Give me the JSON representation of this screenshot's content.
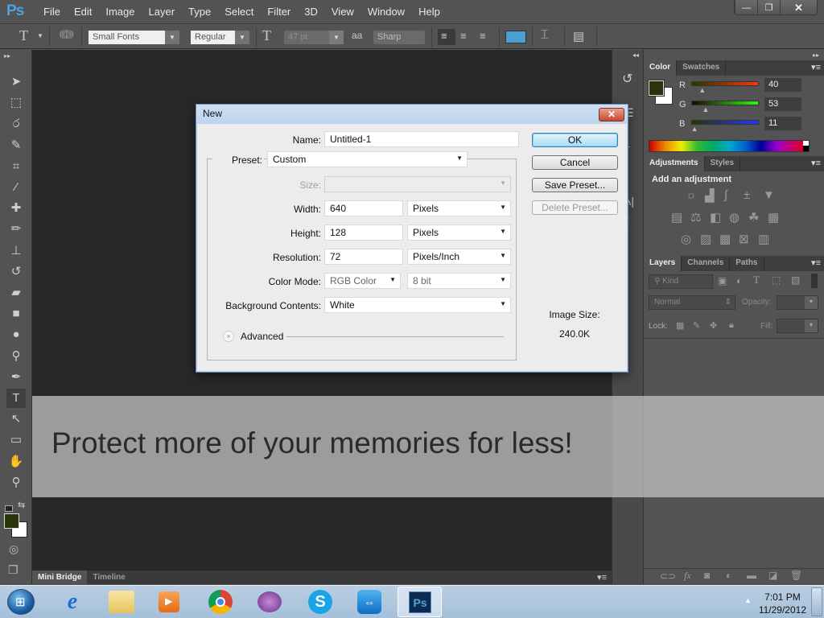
{
  "app": {
    "logo": "Ps"
  },
  "menu": [
    "File",
    "Edit",
    "Image",
    "Layer",
    "Type",
    "Select",
    "Filter",
    "3D",
    "View",
    "Window",
    "Help"
  ],
  "window_controls": {
    "minimize": "—",
    "restore": "❐",
    "close": "✕"
  },
  "options_bar": {
    "tool_icon": "T",
    "font_family": "Small Fonts",
    "font_style": "Regular",
    "font_size": "47 pt",
    "antialias_icon": "aa",
    "antialias": "Sharp",
    "text_color": "#4a9fd4"
  },
  "tools": [
    {
      "name": "move-tool",
      "glyph": "➤"
    },
    {
      "name": "marquee-tool",
      "glyph": "⬚"
    },
    {
      "name": "lasso-tool",
      "glyph": "ර"
    },
    {
      "name": "quick-select-tool",
      "glyph": "✎"
    },
    {
      "name": "crop-tool",
      "glyph": "⌗"
    },
    {
      "name": "eyedropper-tool",
      "glyph": "⁄"
    },
    {
      "name": "healing-brush-tool",
      "glyph": "✚"
    },
    {
      "name": "brush-tool",
      "glyph": "✏"
    },
    {
      "name": "clone-stamp-tool",
      "glyph": "⊥"
    },
    {
      "name": "history-brush-tool",
      "glyph": "↺"
    },
    {
      "name": "eraser-tool",
      "glyph": "▰"
    },
    {
      "name": "gradient-tool",
      "glyph": "■"
    },
    {
      "name": "blur-tool",
      "glyph": "●"
    },
    {
      "name": "dodge-tool",
      "glyph": "⚲"
    },
    {
      "name": "pen-tool",
      "glyph": "✒"
    },
    {
      "name": "type-tool",
      "glyph": "T"
    },
    {
      "name": "path-select-tool",
      "glyph": "↖"
    },
    {
      "name": "shape-tool",
      "glyph": "▭"
    },
    {
      "name": "hand-tool",
      "glyph": "✋"
    },
    {
      "name": "zoom-tool",
      "glyph": "⚲"
    }
  ],
  "swatches": {
    "foreground": "#28350b",
    "background": "#ffffff"
  },
  "mini_bridge": {
    "tabs": [
      "Mini Bridge",
      "Timeline"
    ]
  },
  "dialog": {
    "title": "New",
    "close": "✕",
    "name_label": "Name:",
    "name_value": "Untitled-1",
    "preset_label": "Preset:",
    "preset_value": "Custom",
    "size_label": "Size:",
    "size_value": "",
    "width_label": "Width:",
    "width_value": "640",
    "width_unit": "Pixels",
    "height_label": "Height:",
    "height_value": "128",
    "height_unit": "Pixels",
    "resolution_label": "Resolution:",
    "resolution_value": "72",
    "resolution_unit": "Pixels/Inch",
    "color_mode_label": "Color Mode:",
    "color_mode_value": "RGB Color",
    "bit_depth": "8 bit",
    "bg_label": "Background Contents:",
    "bg_value": "White",
    "advanced": "Advanced",
    "buttons": {
      "ok": "OK",
      "cancel": "Cancel",
      "save_preset": "Save Preset...",
      "delete_preset": "Delete Preset..."
    },
    "image_size_label": "Image Size:",
    "image_size_value": "240.0K"
  },
  "color_panel": {
    "tabs": [
      "Color",
      "Swatches"
    ],
    "channels": [
      {
        "label": "R",
        "value": "40",
        "fraction": 0.157
      },
      {
        "label": "G",
        "value": "53",
        "fraction": 0.208
      },
      {
        "label": "B",
        "value": "11",
        "fraction": 0.043
      }
    ]
  },
  "adjustments_panel": {
    "tabs": [
      "Adjustments",
      "Styles"
    ],
    "heading": "Add an adjustment",
    "rows": [
      [
        "brightness-contrast",
        "levels",
        "curves",
        "exposure",
        "vibrance"
      ],
      [
        "hue-saturation",
        "color-balance",
        "black-white",
        "photo-filter",
        "channel-mixer",
        "color-lookup"
      ],
      [
        "invert",
        "posterize",
        "threshold",
        "selective-color",
        "gradient-map"
      ]
    ]
  },
  "layers_panel": {
    "tabs": [
      "Layers",
      "Channels",
      "Paths"
    ],
    "filter": "Kind",
    "blend_mode": "Normal",
    "opacity_label": "Opacity:",
    "opacity_value": "",
    "lock_label": "Lock:",
    "fill_label": "Fill:",
    "fill_value": ""
  },
  "watermark": {
    "text": "Protect more of your memories for less!"
  },
  "taskbar": {
    "apps": [
      "start",
      "internet-explorer",
      "windows-explorer",
      "media-player",
      "chrome",
      "yahoo-messenger",
      "skype",
      "teamviewer",
      "photoshop"
    ],
    "time": "7:01 PM",
    "date": "11/29/2012"
  }
}
